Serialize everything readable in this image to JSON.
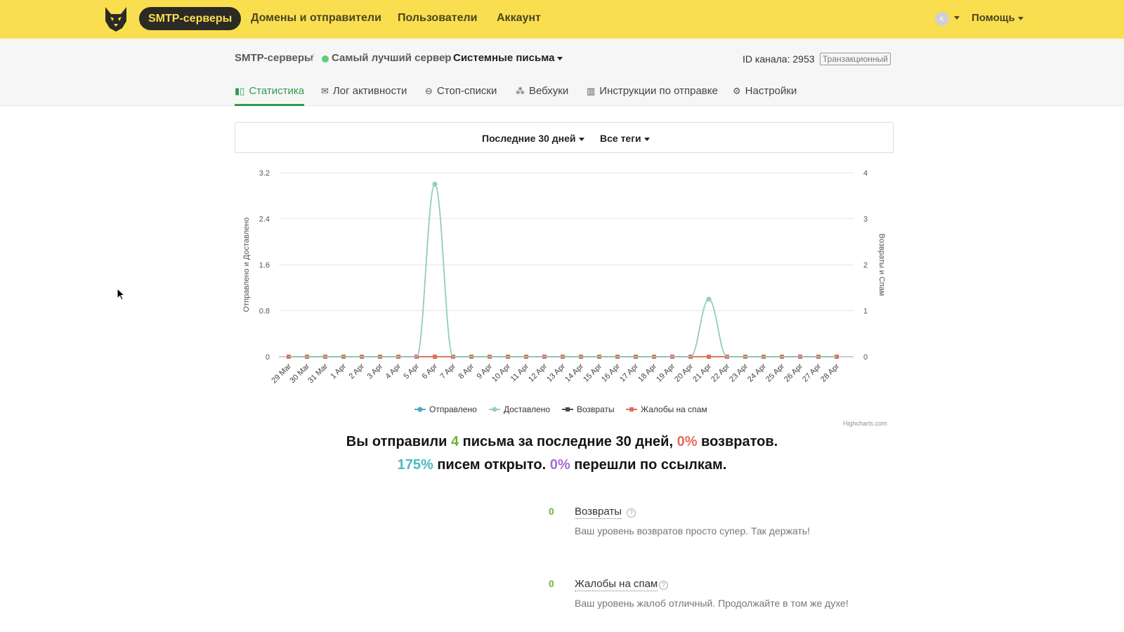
{
  "nav": {
    "active": "SMTP-серверы",
    "links": [
      "Домены и отправители",
      "Пользователи",
      "Аккаунт"
    ],
    "avatar_initial": "K",
    "help": "Помощь"
  },
  "breadcrumb": {
    "root": "SMTP-серверы",
    "server": "Самый лучший сервер",
    "stream": "Системные письма"
  },
  "channel": {
    "label": "ID канала:",
    "id": "2953",
    "type": "Транзакционный"
  },
  "tabs": [
    {
      "label": "Статистика",
      "icon": "bar-chart-icon",
      "active": true
    },
    {
      "label": "Лог активности",
      "icon": "envelope-icon",
      "active": false
    },
    {
      "label": "Стоп-списки",
      "icon": "minus-circle-icon",
      "active": false
    },
    {
      "label": "Вебхуки",
      "icon": "webhook-icon",
      "active": false
    },
    {
      "label": "Инструкции по отправке",
      "icon": "map-icon",
      "active": false
    },
    {
      "label": "Настройки",
      "icon": "gear-icon",
      "active": false
    }
  ],
  "filters": {
    "period": "Последние 30 дней",
    "tags": "Все теги"
  },
  "chart_data": {
    "type": "line",
    "x": [
      "29 Mar",
      "30 Mar",
      "31 Mar",
      "1 Apr",
      "2 Apr",
      "3 Apr",
      "4 Apr",
      "5 Apr",
      "6 Apr",
      "7 Apr",
      "8 Apr",
      "9 Apr",
      "10 Apr",
      "11 Apr",
      "12 Apr",
      "13 Apr",
      "14 Apr",
      "15 Apr",
      "16 Apr",
      "17 Apr",
      "18 Apr",
      "19 Apr",
      "20 Apr",
      "21 Apr",
      "22 Apr",
      "23 Apr",
      "24 Apr",
      "25 Apr",
      "26 Apr",
      "27 Apr",
      "28 Apr"
    ],
    "series": [
      {
        "name": "Отправлено",
        "axis": "left",
        "color": "#4aa8c8",
        "values": [
          0,
          0,
          0,
          0,
          0,
          0,
          0,
          0,
          3,
          0,
          0,
          0,
          0,
          0,
          0,
          0,
          0,
          0,
          0,
          0,
          0,
          0,
          0,
          1,
          0,
          0,
          0,
          0,
          0,
          0,
          0
        ]
      },
      {
        "name": "Доставлено",
        "axis": "left",
        "color": "#93d1bc",
        "values": [
          0,
          0,
          0,
          0,
          0,
          0,
          0,
          0,
          3,
          0,
          0,
          0,
          0,
          0,
          0,
          0,
          0,
          0,
          0,
          0,
          0,
          0,
          0,
          1,
          0,
          0,
          0,
          0,
          0,
          0,
          0
        ]
      },
      {
        "name": "Возвраты",
        "axis": "right",
        "color": "#4a4a4a",
        "values": [
          0,
          0,
          0,
          0,
          0,
          0,
          0,
          0,
          0,
          0,
          0,
          0,
          0,
          0,
          0,
          0,
          0,
          0,
          0,
          0,
          0,
          0,
          0,
          0,
          0,
          0,
          0,
          0,
          0,
          0,
          0
        ]
      },
      {
        "name": "Жалобы на спам",
        "axis": "right",
        "color": "#e36d5a",
        "values": [
          0,
          0,
          0,
          0,
          0,
          0,
          0,
          0,
          0,
          0,
          0,
          0,
          0,
          0,
          0,
          0,
          0,
          0,
          0,
          0,
          0,
          0,
          0,
          0,
          0,
          0,
          0,
          0,
          0,
          0,
          0
        ]
      }
    ],
    "y_left": {
      "label": "Отправлено и Доставлено",
      "ticks": [
        "0",
        "0.8",
        "1.6",
        "2.4",
        "3.2"
      ],
      "lim": [
        0,
        3.2
      ]
    },
    "y_right": {
      "label": "Возвраты и Спам",
      "ticks": [
        "0",
        "1",
        "2",
        "3",
        "4"
      ],
      "lim": [
        0,
        4
      ]
    },
    "grid": true,
    "legend": "bottom-center",
    "credit": "Highcharts.com"
  },
  "summary": {
    "s1_a": "Вы отправили ",
    "s1_sent": "4",
    "s1_b": " письма за последние 30 дней, ",
    "s1_bounce": "0%",
    "s1_c": " возвратов.",
    "s2_open": "175%",
    "s2_a": " писем открыто. ",
    "s2_click": "0%",
    "s2_b": " перешли по ссылкам."
  },
  "metrics": [
    {
      "value": "0",
      "title": "Возвраты",
      "desc": "Ваш уровень возвратов просто супер. Так держать!"
    },
    {
      "value": "0",
      "title": "Жалобы на спам",
      "desc": "Ваш уровень жалоб отличный. Продолжайте в том же духе!"
    }
  ],
  "colors": {
    "brand": "#f9df4f",
    "dark": "#2b2a25",
    "active_tab": "#2e9c4f"
  }
}
